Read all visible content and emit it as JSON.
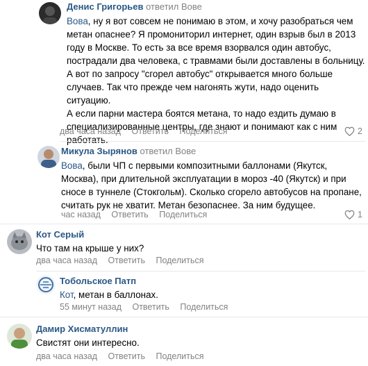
{
  "comments": [
    {
      "author": "Денис Григорьев",
      "reply_to": "ответил Вове",
      "addressee": "Вова",
      "lines": [
        ", ну я вот совсем не понимаю в этом, и хочу разобраться чем",
        "метан опаснее? Я промониторил интернет, один взрыв был в 2013",
        "году в Москве. То есть за все время взорвался один автобус,",
        "пострадали два человека, с травмами были доставлены в больницу.",
        "А вот по запросу \"сгорел автобус\" открывается много больше",
        "случаев. Так что прежде чем нагонять жути, надо оценить ситуацию.",
        "А если парни мастера боятся метана, то надо ездить думаю в",
        "специализированные центры, где знают и понимают как с ним",
        "работать."
      ],
      "time": "два часа назад",
      "reply_label": "Ответить",
      "share_label": "Поделиться",
      "likes": "2"
    },
    {
      "author": "Микула Зырянов",
      "reply_to": "ответил Вове",
      "addressee": "Вова",
      "lines": [
        ", были ЧП с первыми композитными баллонами (Якутск,",
        "Москва), при длительной эксплуатации в мороз -40 (Якутск) и при",
        "сносе в туннеле (Стокгольм). Сколько сгорело автобусов на пропане,",
        "считать рук не хватит. Метан безопаснее. За ним будущее."
      ],
      "time": "час назад",
      "reply_label": "Ответить",
      "share_label": "Поделиться",
      "likes": "1"
    },
    {
      "author": "Кот Серый",
      "lines": [
        "Что там на крыше у них?"
      ],
      "time": "два часа назад",
      "reply_label": "Ответить",
      "share_label": "Поделиться"
    },
    {
      "author": "Тобольское Патп",
      "addressee": "Кот",
      "lines": [
        ", метан в баллонах."
      ],
      "time": "55 минут назад",
      "reply_label": "Ответить",
      "share_label": "Поделиться"
    },
    {
      "author": "Дамир Хисматуллин",
      "lines": [
        "Свистят они интересно."
      ],
      "time": "два часа назад",
      "reply_label": "Ответить",
      "share_label": "Поделиться"
    }
  ],
  "icons": {
    "like": "heart-icon"
  },
  "colors": {
    "link": "#2a5885",
    "meta": "#828282",
    "divider": "#e7e8ec"
  }
}
